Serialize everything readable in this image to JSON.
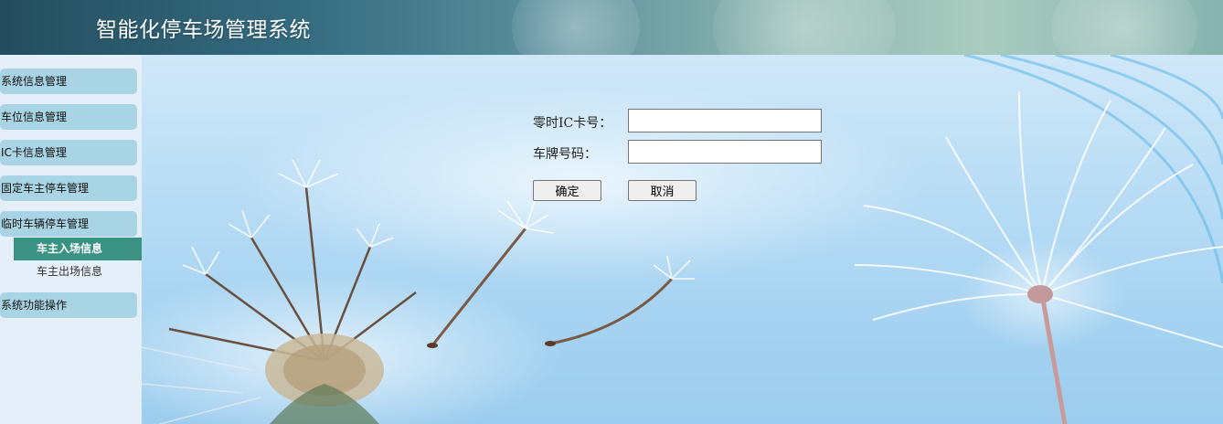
{
  "header": {
    "title": "智能化停车场管理系统"
  },
  "sidebar": {
    "menus": [
      {
        "label": "系统信息管理"
      },
      {
        "label": "车位信息管理"
      },
      {
        "label": "IC卡信息管理"
      },
      {
        "label": "固定车主停车管理"
      },
      {
        "label": "临时车辆停车管理"
      },
      {
        "label": "系统功能操作"
      }
    ],
    "submenus": [
      {
        "label": "车主入场信息",
        "active": true
      },
      {
        "label": "车主出场信息",
        "active": false
      }
    ]
  },
  "form": {
    "ic_label": "零时IC卡号：",
    "ic_value": "",
    "plate_label": "车牌号码：",
    "plate_value": "",
    "confirm_label": "确定",
    "cancel_label": "取消"
  },
  "colors": {
    "menu_bg": "#a8d4e3",
    "submenu_active_bg": "#3a9283",
    "sidebar_bg": "#e4effa"
  }
}
